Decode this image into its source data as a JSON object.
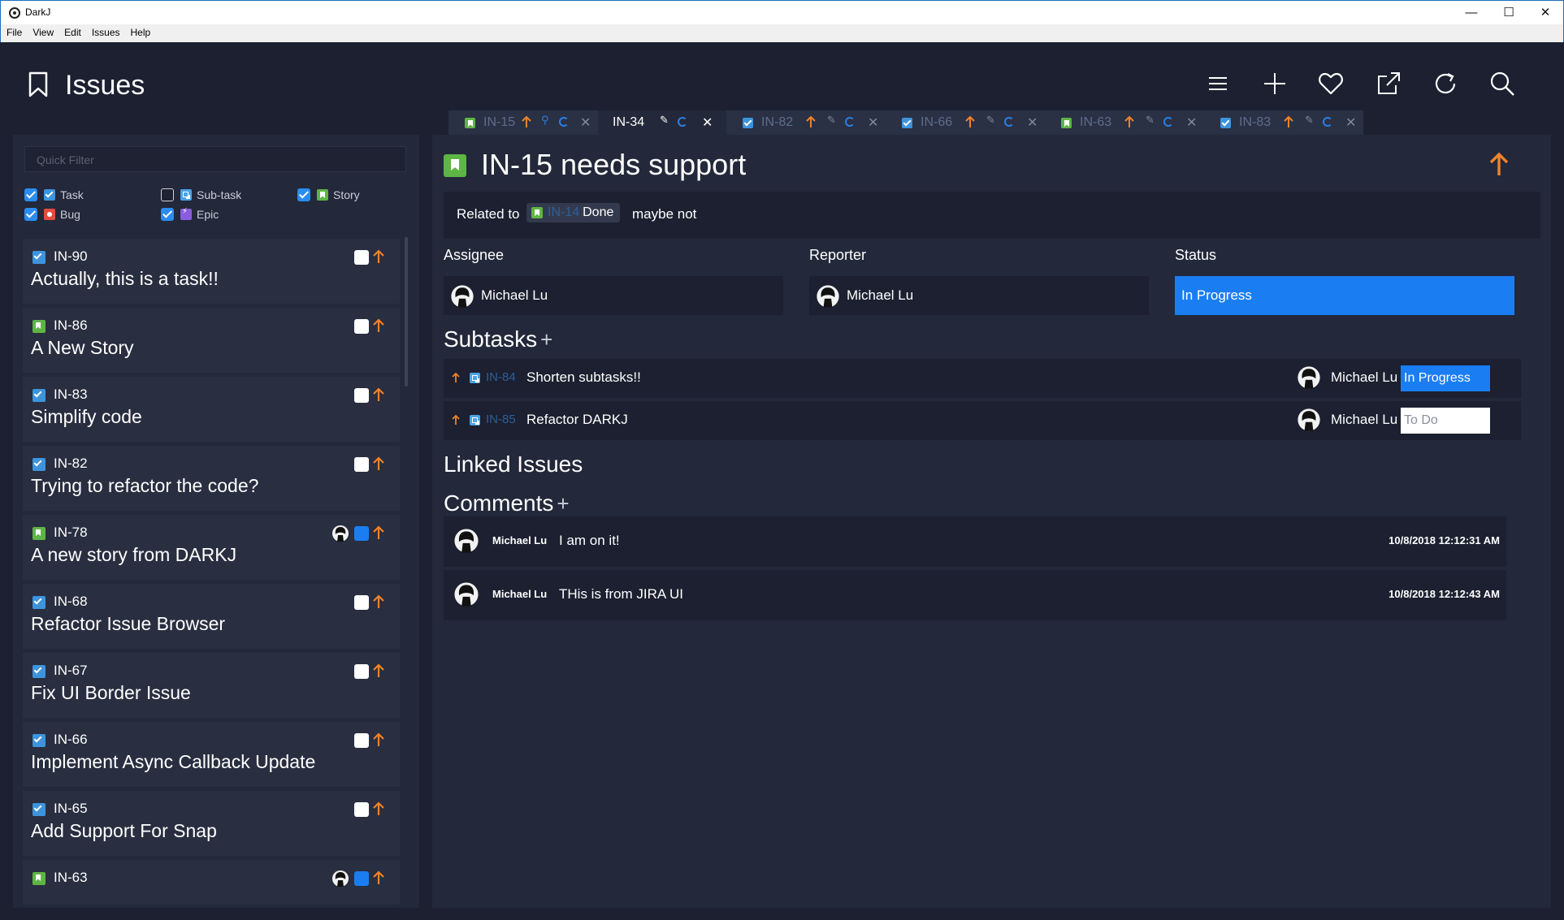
{
  "window": {
    "title": "DarkJ",
    "minimize": "—",
    "maximize": "☐",
    "close": "✕"
  },
  "menu": [
    "File",
    "View",
    "Edit",
    "Issues",
    "Help"
  ],
  "header": {
    "title": "Issues",
    "toolbar_icons": [
      "menu-icon",
      "add-icon",
      "heart-icon",
      "external-link-icon",
      "refresh-icon",
      "search-icon"
    ]
  },
  "filter": {
    "placeholder": "Quick Filter",
    "types": [
      {
        "label": "Task",
        "checked": true,
        "icon": "task-icon"
      },
      {
        "label": "Sub-task",
        "checked": false,
        "icon": "subtask-icon"
      },
      {
        "label": "Story",
        "checked": true,
        "icon": "story-icon"
      },
      {
        "label": "Bug",
        "checked": true,
        "icon": "bug-icon"
      },
      {
        "label": "Epic",
        "checked": true,
        "icon": "epic-icon"
      }
    ]
  },
  "issues": [
    {
      "key": "IN-90",
      "type": "task",
      "summary": "Actually, this is a task!!",
      "assigned": false
    },
    {
      "key": "IN-86",
      "type": "story",
      "summary": "A New Story",
      "assigned": false
    },
    {
      "key": "IN-83",
      "type": "task",
      "summary": "Simplify code",
      "assigned": false
    },
    {
      "key": "IN-82",
      "type": "task",
      "summary": "Trying to refactor the code?",
      "assigned": false
    },
    {
      "key": "IN-78",
      "type": "story",
      "summary": "A new story from DARKJ",
      "assigned": true
    },
    {
      "key": "IN-68",
      "type": "task",
      "summary": "Refactor Issue Browser",
      "assigned": false
    },
    {
      "key": "IN-67",
      "type": "task",
      "summary": "Fix UI Border Issue",
      "assigned": false
    },
    {
      "key": "IN-66",
      "type": "task",
      "summary": "Implement Async Callback Update",
      "assigned": false
    },
    {
      "key": "IN-65",
      "type": "task",
      "summary": "Add Support For Snap",
      "assigned": false
    },
    {
      "key": "IN-63",
      "type": "story",
      "summary": "",
      "assigned": true
    }
  ],
  "tabs": [
    {
      "key": "IN-15",
      "type": "story",
      "active": false
    },
    {
      "key": "IN-34",
      "type": "",
      "active": true
    },
    {
      "key": "IN-82",
      "type": "task",
      "active": false
    },
    {
      "key": "IN-66",
      "type": "task",
      "active": false
    },
    {
      "key": "IN-63",
      "type": "story",
      "active": false
    },
    {
      "key": "IN-83",
      "type": "task",
      "active": false
    }
  ],
  "detail": {
    "title": "IN-15 needs support",
    "related_label": "Related to",
    "related_key": "IN-14",
    "related_status": "Done",
    "related_note": "maybe not",
    "assignee_label": "Assignee",
    "assignee": "Michael Lu",
    "reporter_label": "Reporter",
    "reporter": "Michael Lu",
    "status_label": "Status",
    "status": "In Progress",
    "subtasks_heading": "Subtasks",
    "subtasks": [
      {
        "key": "IN-84",
        "summary": "Shorten subtasks!!",
        "assignee": "Michael Lu",
        "status": "In Progress"
      },
      {
        "key": "IN-85",
        "summary": "Refactor DARKJ",
        "assignee": "Michael Lu",
        "status": "To Do"
      }
    ],
    "linked_heading": "Linked Issues",
    "comments_heading": "Comments",
    "comments": [
      {
        "author": "Michael Lu",
        "text": "I am on it!",
        "time": "10/8/2018 12:12:31 AM"
      },
      {
        "author": "Michael Lu",
        "text": "THis is from JIRA UI",
        "time": "10/8/2018 12:12:43 AM"
      }
    ],
    "plus": "+"
  },
  "colors": {
    "accent": "#1a7ef2",
    "priority": "#f0822a",
    "story": "#5fb543",
    "task": "#3d94dd",
    "bug": "#e44c3c",
    "epic": "#8a5cde"
  }
}
